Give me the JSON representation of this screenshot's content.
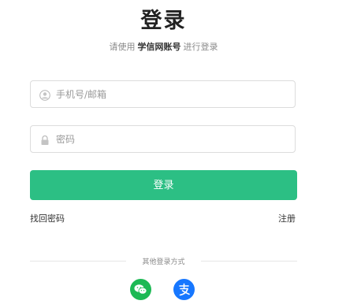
{
  "header": {
    "title": "登录",
    "subtitle_prefix": "请使用",
    "subtitle_account": "学信网账号",
    "subtitle_suffix": "进行登录"
  },
  "form": {
    "phone_placeholder": "手机号/邮箱",
    "password_placeholder": "密码",
    "login_label": "登录"
  },
  "links": {
    "forgot_password": "找回密码",
    "register": "注册"
  },
  "other_login": {
    "label": "其他登录方式",
    "options": [
      {
        "icon": "wechat-icon",
        "color": "#1db954"
      },
      {
        "icon": "alipay-icon",
        "color": "#1677ff"
      }
    ]
  },
  "colors": {
    "primary": "#2cbf84",
    "border": "#dcdcdc"
  }
}
